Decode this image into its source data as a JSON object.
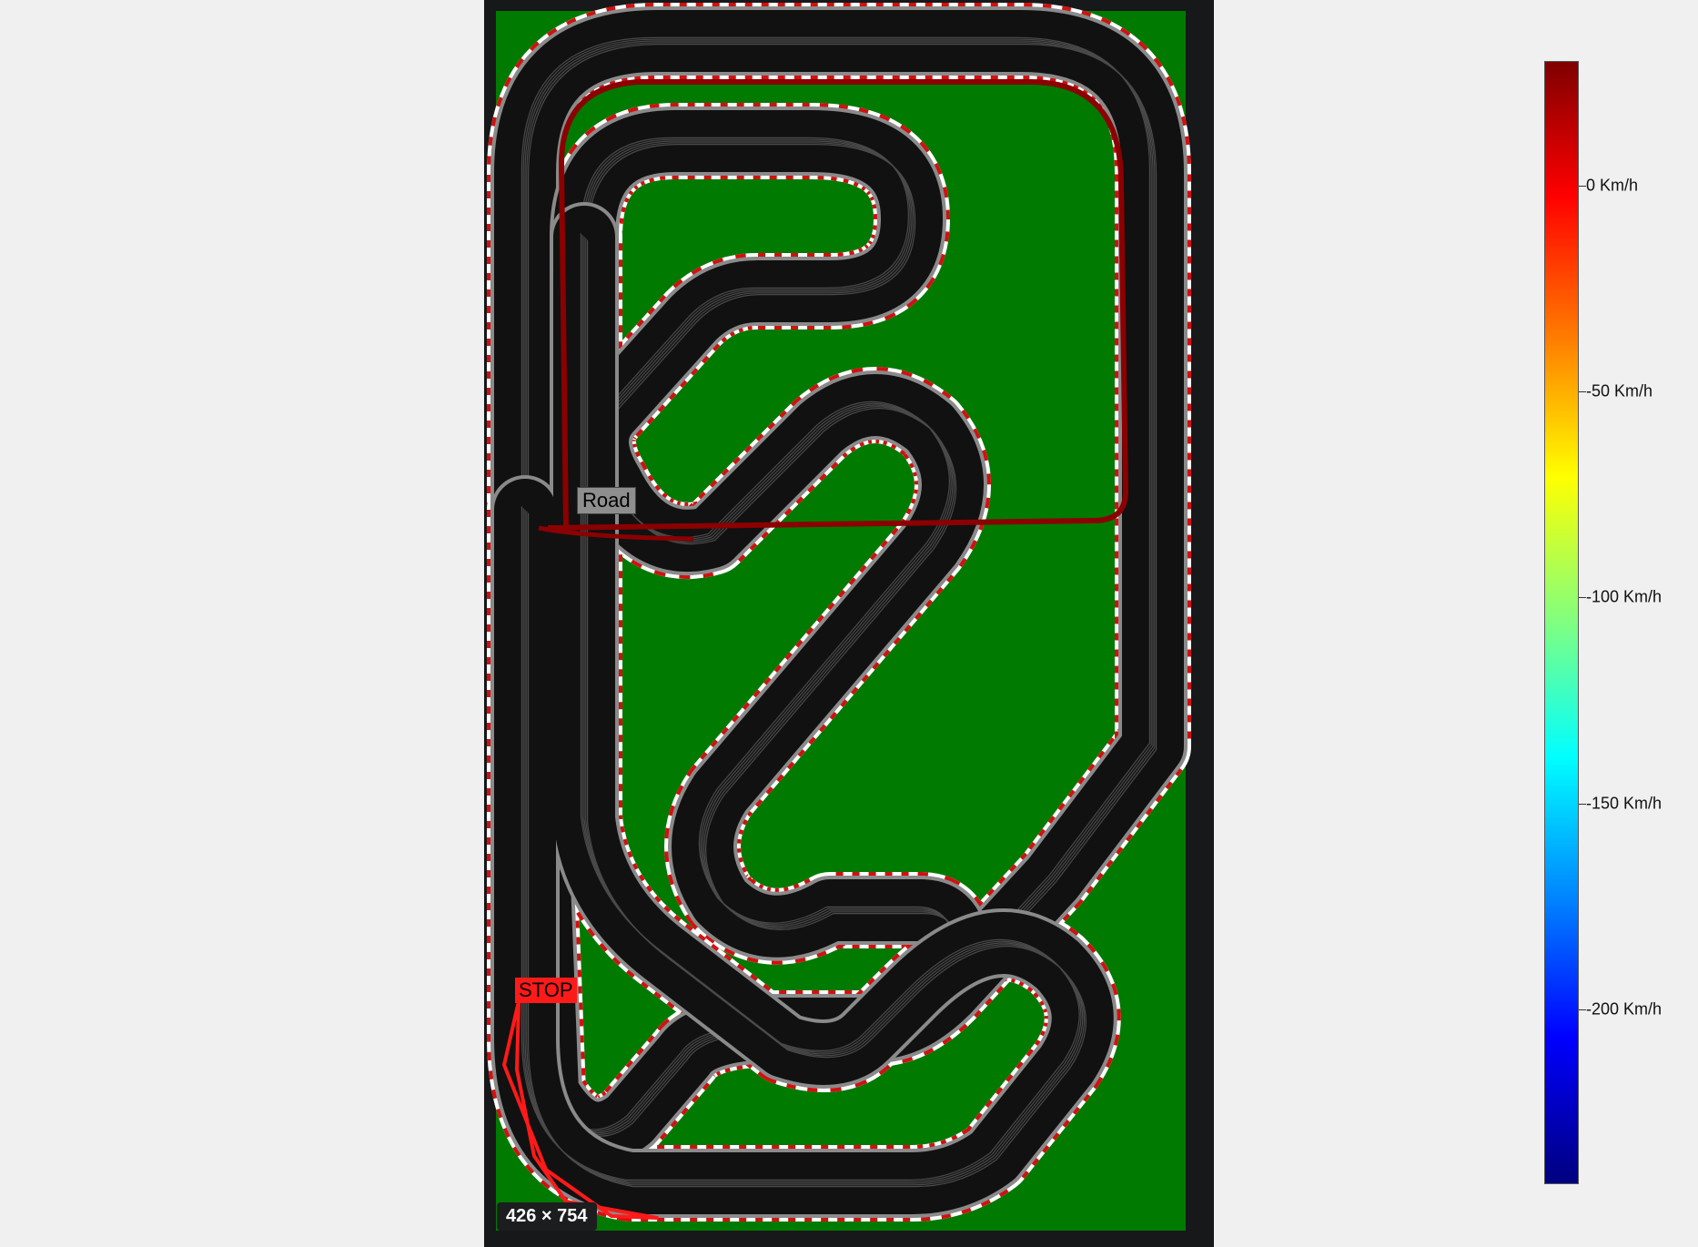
{
  "track": {
    "image_size_label": "426 × 754",
    "labels": {
      "road": "Road",
      "stop": "STOP"
    },
    "colors": {
      "grass": "#007a00",
      "asphalt": "#111111",
      "edge": "#8a8a8a",
      "lane": "#5a5a5a",
      "kerb_red": "#d21010",
      "kerb_white": "#ffffff",
      "route": "#8b0000",
      "stop_path": "#ff1a1a"
    }
  },
  "colorbar": {
    "ticks": [
      {
        "label": "0 Km/h"
      },
      {
        "label": "-50 Km/h"
      },
      {
        "label": "-100 Km/h"
      },
      {
        "label": "-150 Km/h"
      },
      {
        "label": "-200 Km/h"
      }
    ],
    "colormap": "jet"
  }
}
